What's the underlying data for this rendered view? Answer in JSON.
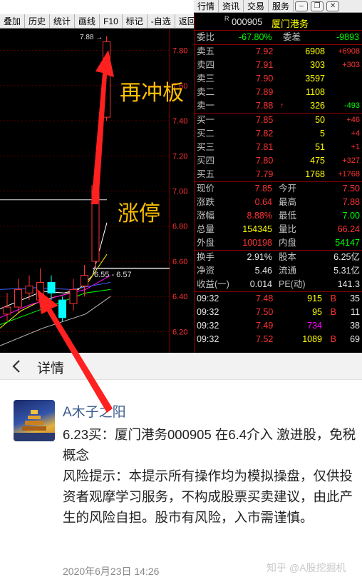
{
  "top_menu": {
    "items": [
      "行情",
      "资讯",
      "交易",
      "服务"
    ]
  },
  "toolbar": {
    "items": [
      "叠加",
      "历史",
      "统计",
      "画线",
      "F10",
      "标记",
      "-自选",
      "返回"
    ]
  },
  "chart": {
    "price_labels": [
      "7.80",
      "7.60",
      "7.40",
      "7.20",
      "7.00",
      "6.80",
      "6.60",
      "6.40",
      "6.20"
    ],
    "price_ticks": [
      7.8,
      7.6,
      7.4,
      7.2,
      7.0,
      6.8,
      6.6,
      6.4,
      6.2
    ],
    "high_marker": "7.88",
    "range_label": "6.55 - 6.57",
    "annotations": {
      "reboard": "再冲板",
      "limit_up": "涨停"
    }
  },
  "chart_data": {
    "type": "candlestick",
    "y_range": [
      6.08,
      7.92
    ],
    "candles": [
      {
        "o": 6.3,
        "c": 6.34,
        "h": 6.42,
        "l": 6.26,
        "up": true
      },
      {
        "o": 6.34,
        "c": 6.44,
        "h": 6.5,
        "l": 6.3,
        "up": true
      },
      {
        "o": 6.42,
        "c": 6.46,
        "h": 6.52,
        "l": 6.38,
        "up": true
      },
      {
        "o": 6.38,
        "c": 6.48,
        "h": 6.56,
        "l": 6.34,
        "up": true
      },
      {
        "o": 6.48,
        "c": 6.42,
        "h": 6.52,
        "l": 6.38,
        "up": false
      },
      {
        "o": 6.38,
        "c": 6.28,
        "h": 6.4,
        "l": 6.26,
        "up": false
      },
      {
        "o": 6.36,
        "c": 6.44,
        "h": 6.5,
        "l": 6.32,
        "up": true
      },
      {
        "o": 6.46,
        "c": 6.52,
        "h": 6.58,
        "l": 6.4,
        "up": true
      },
      {
        "o": 6.6,
        "c": 7.03,
        "h": 7.18,
        "l": 6.56,
        "up": true
      },
      {
        "o": 7.42,
        "c": 7.85,
        "h": 7.88,
        "l": 7.4,
        "up": true
      }
    ]
  },
  "quote": {
    "code": "000905",
    "name": "厦门港务",
    "r_mark": "R",
    "weibi": {
      "label": "委比",
      "value": "-67.80%",
      "diff_label": "委差",
      "diff": "-9893"
    },
    "asks": [
      {
        "label": "卖五",
        "price": "7.92",
        "vol": "6908",
        "chg": "+6908"
      },
      {
        "label": "卖四",
        "price": "7.91",
        "vol": "303",
        "chg": "+303"
      },
      {
        "label": "卖三",
        "price": "7.90",
        "vol": "3597",
        "chg": ""
      },
      {
        "label": "卖二",
        "price": "7.89",
        "vol": "1108",
        "chg": ""
      },
      {
        "label": "卖一",
        "price": "7.88",
        "vol": "326",
        "chg": "-493",
        "arrow": "↑"
      }
    ],
    "bids": [
      {
        "label": "买一",
        "price": "7.85",
        "vol": "50",
        "chg": "+46"
      },
      {
        "label": "买二",
        "price": "7.82",
        "vol": "5",
        "chg": "+4"
      },
      {
        "label": "买三",
        "price": "7.81",
        "vol": "51",
        "chg": "+1"
      },
      {
        "label": "买四",
        "price": "7.80",
        "vol": "475",
        "chg": "+327"
      },
      {
        "label": "买五",
        "price": "7.79",
        "vol": "1768",
        "chg": "+1768"
      }
    ],
    "stats1": [
      {
        "l1": "现价",
        "v1": "7.85",
        "l2": "今开",
        "v2": "7.50"
      },
      {
        "l1": "涨跌",
        "v1": "0.64",
        "l2": "最高",
        "v2": "7.88"
      },
      {
        "l1": "涨幅",
        "v1": "8.88%",
        "l2": "最低",
        "v2": "7.00"
      },
      {
        "l1": "总量",
        "v1": "154345",
        "l2": "量比",
        "v2": "66.24"
      },
      {
        "l1": "外盘",
        "v1": "100198",
        "l2": "内盘",
        "v2": "54147"
      }
    ],
    "stats2": [
      {
        "l1": "换手",
        "v1": "2.91%",
        "l2": "股本",
        "v2": "6.25亿"
      },
      {
        "l1": "净资",
        "v1": "5.46",
        "l2": "流通",
        "v2": "5.31亿"
      },
      {
        "l1": "收益(一)",
        "v1": "0.014",
        "l2": "PE(动)",
        "v2": "141.3"
      }
    ],
    "ticks": [
      {
        "time": "09:32",
        "price": "7.48",
        "vol": "915",
        "side": "B",
        "n": "35"
      },
      {
        "time": "09:32",
        "price": "7.50",
        "vol": "95",
        "side": "B",
        "n": "11"
      },
      {
        "time": "09:32",
        "price": "7.49",
        "vol": "734",
        "side": "",
        "n": "38"
      },
      {
        "time": "09:32",
        "price": "7.52",
        "vol": "1089",
        "side": "B",
        "n": "69"
      }
    ]
  },
  "detail": {
    "title": "详情",
    "author": "A木子之阳",
    "body": "6.23买：厦门港务000905 在6.4介入 激进股，免税概念\n风险提示：本提示所有操作均为模拟操盘，仅供投资者观摩学习服务，不构成股票买卖建议，由此产生的风险自担。股市有风险，入市需谨慎。",
    "time": "2020年6月23日 14:26",
    "watermark": "知乎 @A股挖掘机"
  },
  "colors": {
    "up": "#ff3232",
    "down": "#00ffff",
    "annotation": "#ffc000",
    "arrow": "#ff2020"
  }
}
